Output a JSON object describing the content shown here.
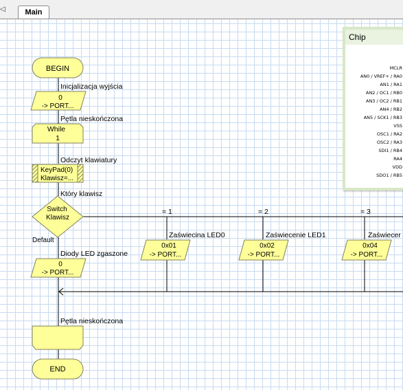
{
  "tabs": {
    "arrow": "◁",
    "main": "Main"
  },
  "flow": {
    "begin": "BEGIN",
    "end": "END",
    "init_comment": "Inicjalizacja wyjścia",
    "init_line1": "0",
    "init_line2": "-> PORT...",
    "loop_comment": "Pętla nieskończona",
    "while_label": "While",
    "while_cond": "1",
    "read_comment": "Odczyt klawiatury",
    "keypad_line1": "KeyPad(0)",
    "keypad_line2": "Klawisz=...",
    "which_comment": "Który klawisz",
    "switch_line1": "Switch",
    "switch_line2": "Klawisz",
    "default_label": "Default",
    "default_comment": "Diody LED zgaszone",
    "default_line1": "0",
    "default_line2": "-> PORT...",
    "case1_label": "= 1",
    "case1_comment": "Zaświecina LED0",
    "case1_line1": "0x01",
    "case1_line2": "-> PORT...",
    "case2_label": "= 2",
    "case2_comment": "Zaświecenie LED1",
    "case2_line1": "0x02",
    "case2_line2": "-> PORT...",
    "case3_label": "= 3",
    "case3_comment": "Zaświecer",
    "case3_line1": "0x04",
    "case3_line2": "-> PORT...",
    "loop_end_comment": "Pętla nieskończona"
  },
  "chip": {
    "title": "Chip",
    "pins": [
      "MCLR",
      "AN0 / VREF+ / RA0",
      "AN1 / RA1",
      "AN2 / OC1 / RB0",
      "AN3 / OC2 / RB1",
      "AN4 / RB2",
      "AN5 / SCK1 / RB3",
      "VSS",
      "OSC1 / RA2",
      "OSC2 / RA3",
      "SDI1 / RB4",
      "RA4",
      "VDD",
      "SDO1 / RB5"
    ]
  },
  "colors": {
    "shape_fill": "#ffff99",
    "shape_stroke": "#808060",
    "grid": "#c7daf0",
    "chip_border": "#d8e8c8"
  }
}
